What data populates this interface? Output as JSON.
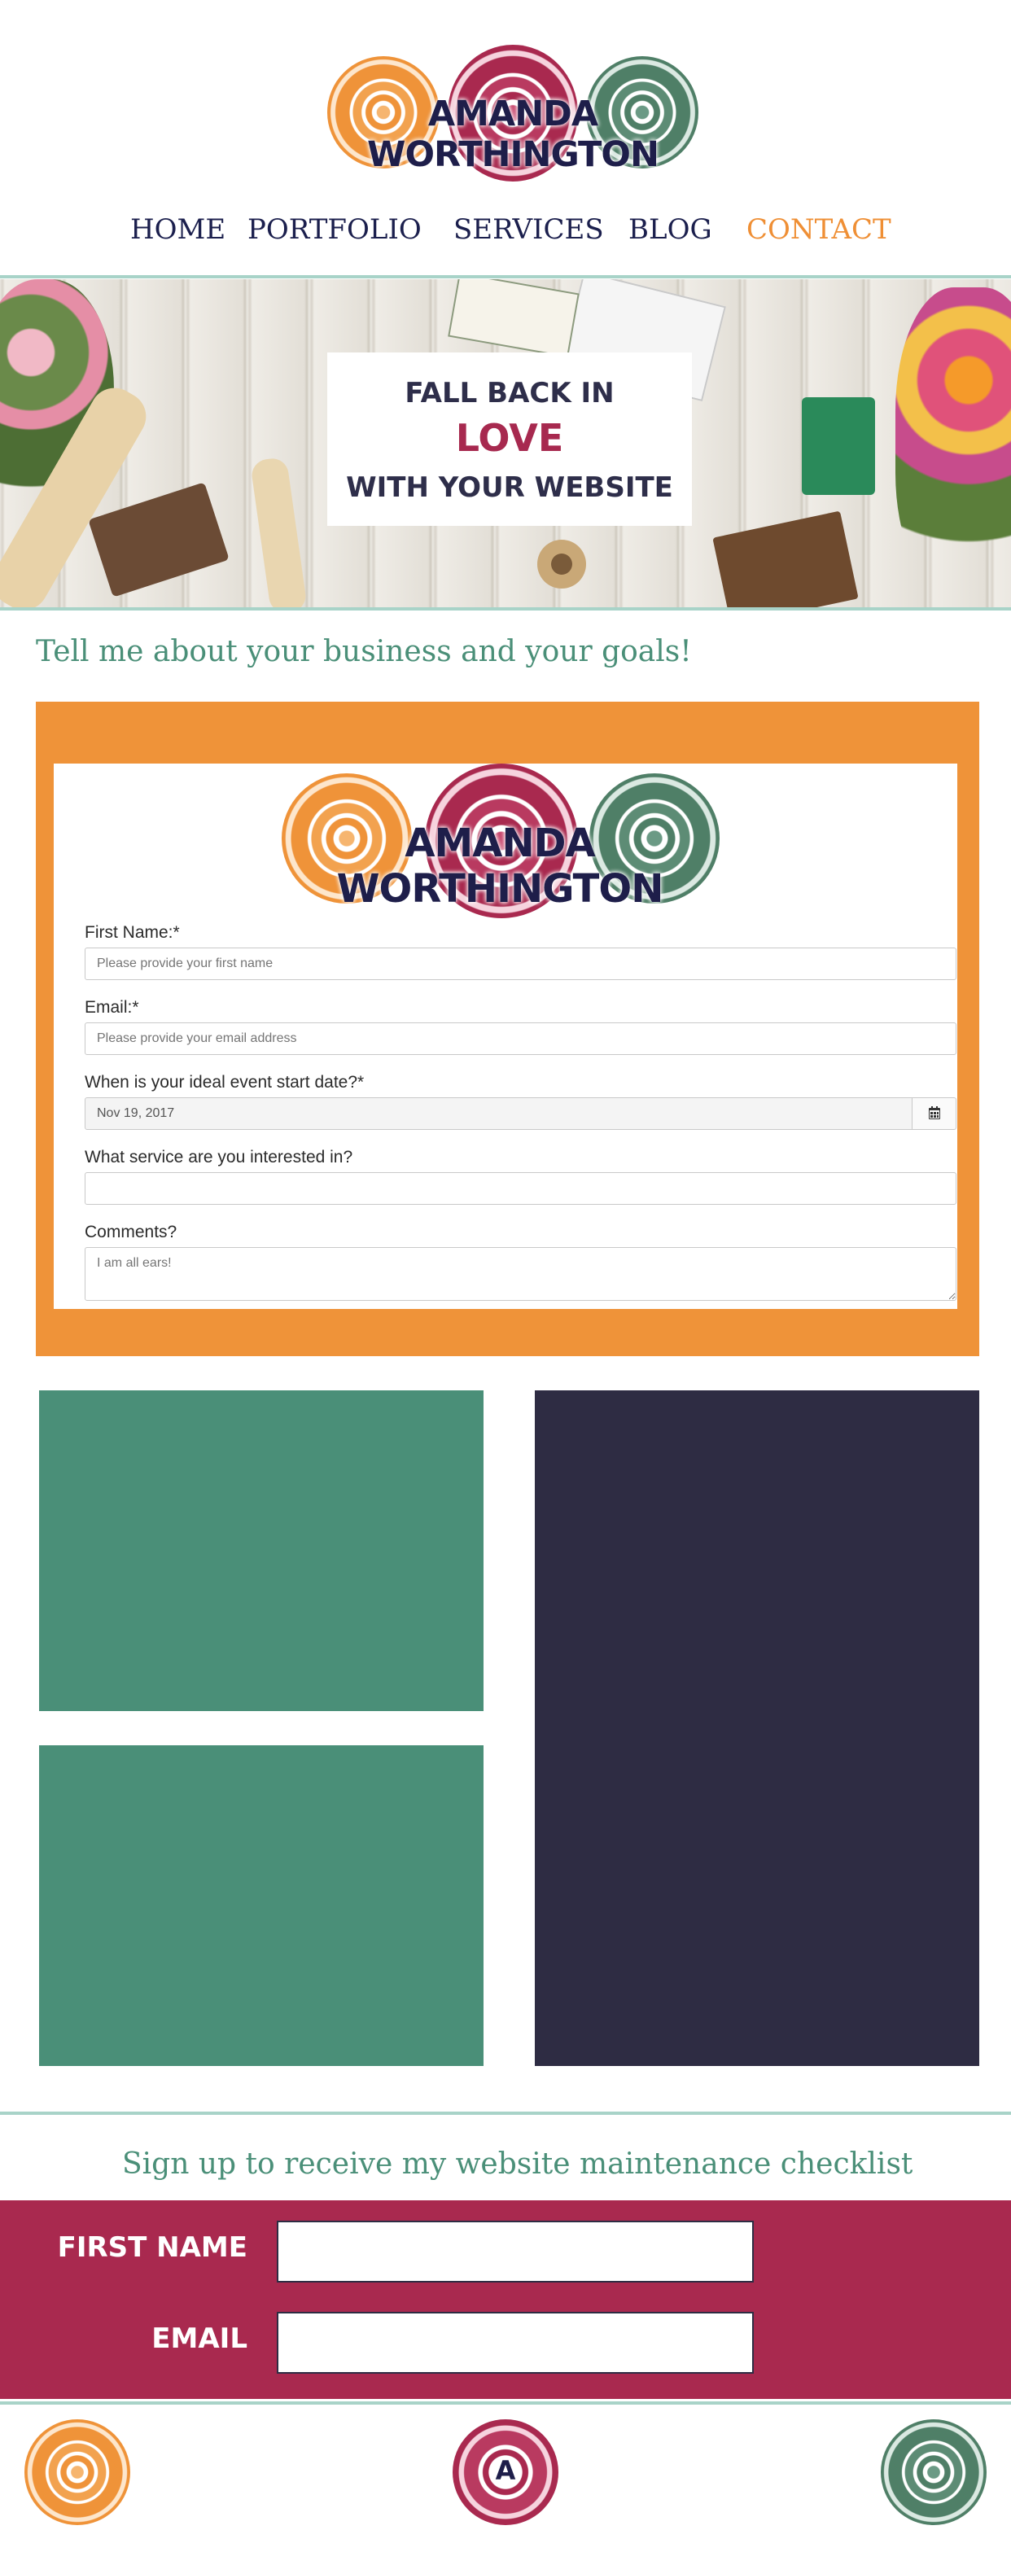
{
  "brand": {
    "name": "AMANDA WORTHINGTON",
    "footer_initial": "A"
  },
  "nav": {
    "items": [
      {
        "label": "HOME"
      },
      {
        "label": "PORTFOLIO"
      },
      {
        "label": "SERVICES"
      },
      {
        "label": "BLOG"
      },
      {
        "label": "CONTACT"
      }
    ],
    "active": "CONTACT"
  },
  "hero": {
    "line1": "FALL BACK IN",
    "line2": "LOVE",
    "line3": "WITH YOUR WEBSITE"
  },
  "contact": {
    "heading": "Tell me about your business and your goals!",
    "first_name": {
      "label": "First Name:*",
      "placeholder": "Please provide your first name",
      "value": ""
    },
    "email": {
      "label": "Email:*",
      "placeholder": "Please provide your email address",
      "value": ""
    },
    "event_date": {
      "label": "When is your ideal event start date?*",
      "value": "Nov 19, 2017"
    },
    "service": {
      "label": "What service are you interested in?",
      "value": ""
    },
    "comments": {
      "label": "Comments?",
      "placeholder": "I am all ears!",
      "value": ""
    }
  },
  "signup": {
    "heading": "Sign up to receive my website maintenance checklist",
    "first_name_label": "FIRST NAME",
    "email_label": "EMAIL"
  },
  "colors": {
    "orange": "#ef9339",
    "magenta": "#a9294f",
    "teal": "#4a8f78",
    "navy": "#2e2c43",
    "nav_text": "#1b1f4d",
    "nav_active": "#ef8f35"
  },
  "icons": [
    "calendar-icon",
    "resize-grip-icon",
    "medallion-icon"
  ]
}
